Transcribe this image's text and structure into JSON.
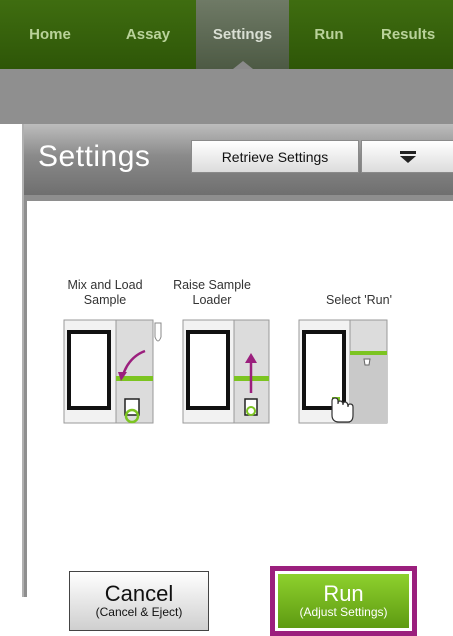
{
  "nav": {
    "tabs": [
      {
        "label": "Home"
      },
      {
        "label": "Assay"
      },
      {
        "label": "Settings"
      },
      {
        "label": "Run"
      },
      {
        "label": "Results"
      }
    ]
  },
  "panel": {
    "title": "Settings",
    "retrieve_label": "Retrieve Settings"
  },
  "steps": [
    {
      "label": "Mix and Load Sample"
    },
    {
      "label": "Raise Sample Loader"
    },
    {
      "label": "Select 'Run'"
    }
  ],
  "cancel": {
    "label": "Cancel",
    "sublabel": "(Cancel & Eject)"
  },
  "run": {
    "label": "Run",
    "sublabel": "(Adjust Settings)"
  },
  "colors": {
    "nav_green": "#3f6d10",
    "accent_green": "#7cc421",
    "highlight_magenta": "#9b1f7d"
  }
}
